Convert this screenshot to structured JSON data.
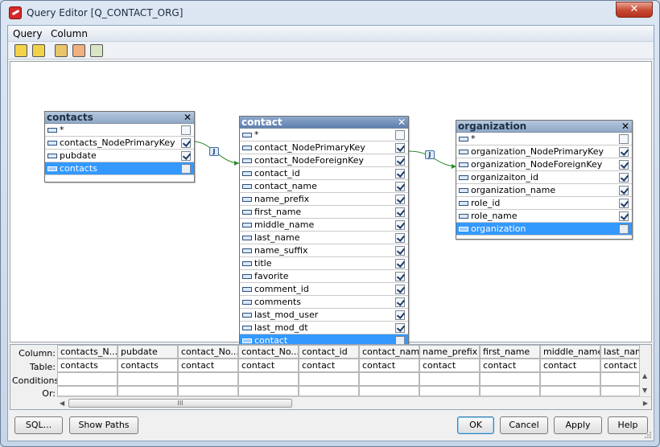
{
  "window": {
    "title": "Query Editor [Q_CONTACT_ORG]",
    "close_glyph": "✕"
  },
  "menu": [
    "Query",
    "Column"
  ],
  "toolbar_icons": [
    "save-icon",
    "save-as-icon",
    "paste-table-icon",
    "remove-table-icon",
    "function-icon"
  ],
  "tables": {
    "contacts": {
      "title": "contacts",
      "rows": [
        {
          "label": "*",
          "checked": false,
          "selected": false
        },
        {
          "label": "contacts_NodePrimaryKey",
          "checked": true,
          "selected": false
        },
        {
          "label": "pubdate",
          "checked": true,
          "selected": false
        },
        {
          "label": "contacts",
          "checked": false,
          "selected": true
        }
      ]
    },
    "contact": {
      "title": "contact",
      "rows": [
        {
          "label": "*",
          "checked": false,
          "selected": false
        },
        {
          "label": "contact_NodePrimaryKey",
          "checked": true,
          "selected": false
        },
        {
          "label": "contact_NodeForeignKey",
          "checked": true,
          "selected": false
        },
        {
          "label": "contact_id",
          "checked": true,
          "selected": false
        },
        {
          "label": "contact_name",
          "checked": true,
          "selected": false
        },
        {
          "label": "name_prefix",
          "checked": true,
          "selected": false
        },
        {
          "label": "first_name",
          "checked": true,
          "selected": false
        },
        {
          "label": "middle_name",
          "checked": true,
          "selected": false
        },
        {
          "label": "last_name",
          "checked": true,
          "selected": false
        },
        {
          "label": "name_suffix",
          "checked": true,
          "selected": false
        },
        {
          "label": "title",
          "checked": true,
          "selected": false
        },
        {
          "label": "favorite",
          "checked": true,
          "selected": false
        },
        {
          "label": "comment_id",
          "checked": true,
          "selected": false
        },
        {
          "label": "comments",
          "checked": true,
          "selected": false
        },
        {
          "label": "last_mod_user",
          "checked": true,
          "selected": false
        },
        {
          "label": "last_mod_dt",
          "checked": true,
          "selected": false
        },
        {
          "label": "contact",
          "checked": false,
          "selected": true
        }
      ]
    },
    "organization": {
      "title": "organization",
      "rows": [
        {
          "label": "*",
          "checked": false,
          "selected": false
        },
        {
          "label": "organization_NodePrimaryKey",
          "checked": true,
          "selected": false
        },
        {
          "label": "organization_NodeForeignKey",
          "checked": true,
          "selected": false
        },
        {
          "label": "organizaiton_id",
          "checked": true,
          "selected": false
        },
        {
          "label": "organization_name",
          "checked": true,
          "selected": false
        },
        {
          "label": "role_id",
          "checked": true,
          "selected": false
        },
        {
          "label": "role_name",
          "checked": true,
          "selected": false
        },
        {
          "label": "organization",
          "checked": false,
          "selected": true
        }
      ]
    }
  },
  "join_badge": "J",
  "grid": {
    "labels": {
      "column": "Column:",
      "table": "Table:",
      "conditions": "Conditions:",
      "or": "Or:"
    },
    "columns": [
      "contacts_N...",
      "pubdate",
      "contact_No...",
      "contact_No...",
      "contact_id",
      "contact_name",
      "name_prefix",
      "first_name",
      "middle_name",
      "last_name"
    ],
    "tables": [
      "contacts",
      "contacts",
      "contact",
      "contact",
      "contact",
      "contact",
      "contact",
      "contact",
      "contact",
      "contact"
    ],
    "scroll_thumb": "III"
  },
  "buttons": {
    "sql": "SQL...",
    "show_paths": "Show Paths",
    "ok": "OK",
    "cancel": "Cancel",
    "apply": "Apply",
    "help": "Help"
  }
}
